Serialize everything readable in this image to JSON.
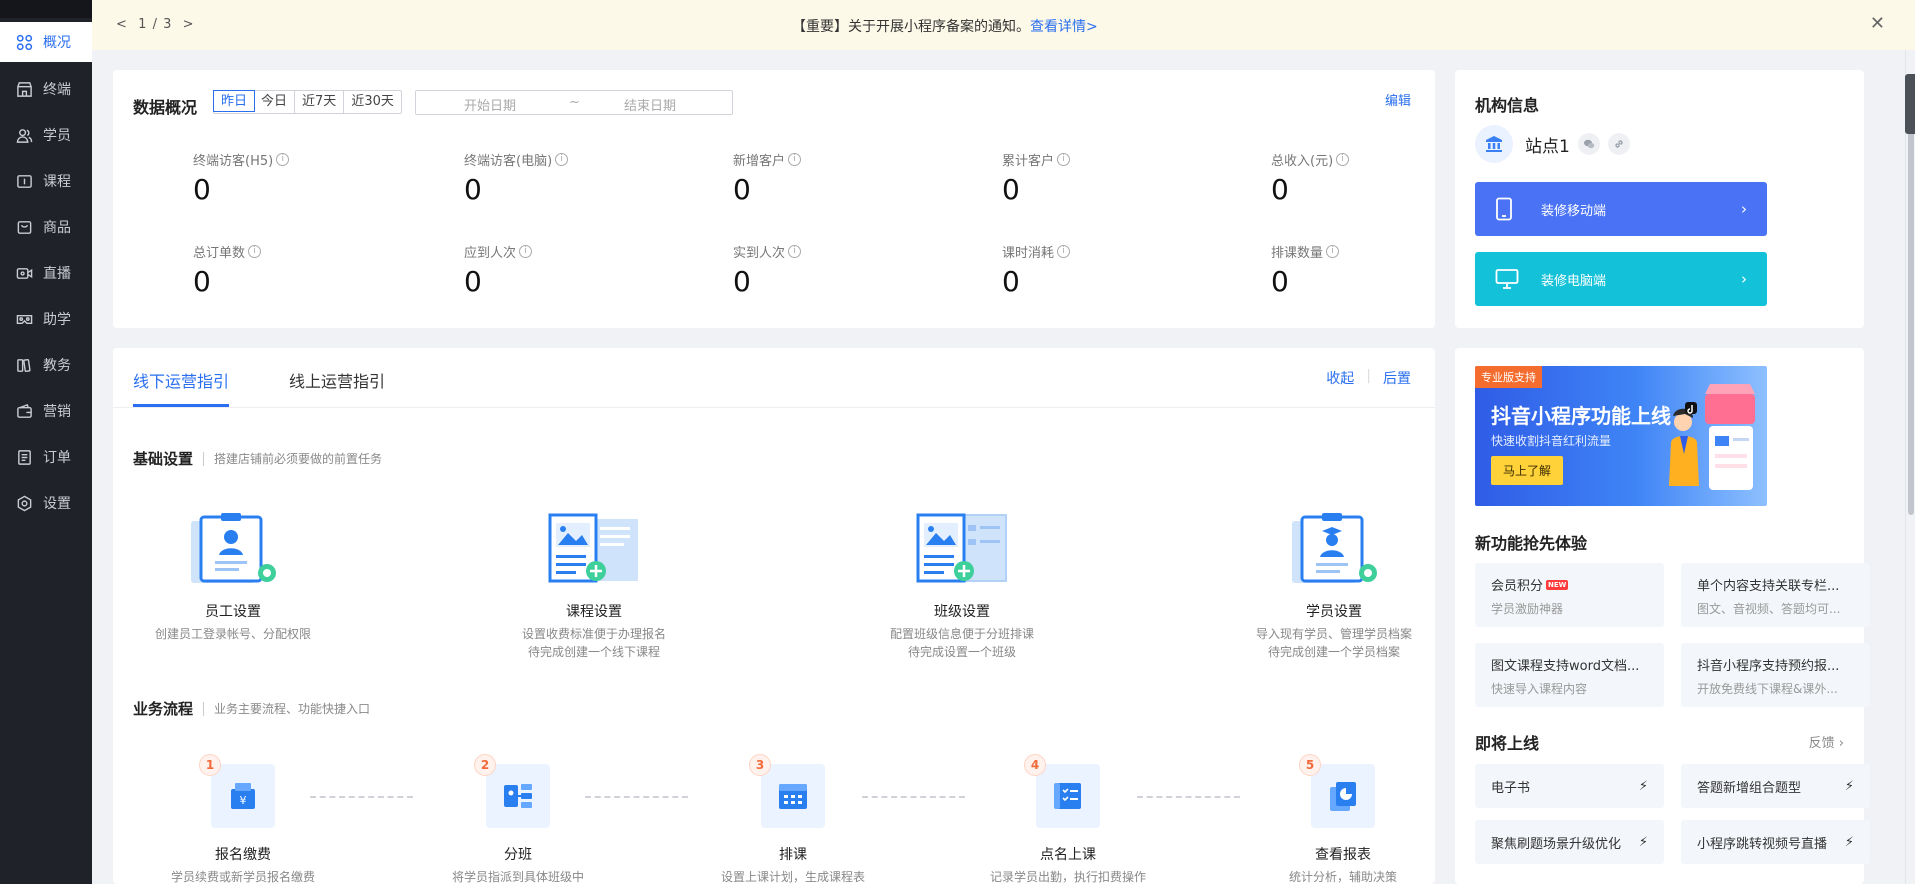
{
  "sidebar": {
    "items": [
      {
        "label": "概况",
        "icon": "grid-icon"
      },
      {
        "label": "终端",
        "icon": "store-icon"
      },
      {
        "label": "学员",
        "icon": "users-icon"
      },
      {
        "label": "课程",
        "icon": "course-icon"
      },
      {
        "label": "商品",
        "icon": "bag-icon"
      },
      {
        "label": "直播",
        "icon": "live-icon"
      },
      {
        "label": "助学",
        "icon": "vr-icon"
      },
      {
        "label": "教务",
        "icon": "book-icon"
      },
      {
        "label": "营销",
        "icon": "wallet-icon"
      },
      {
        "label": "订单",
        "icon": "order-icon"
      },
      {
        "label": "设置",
        "icon": "gear-icon"
      }
    ]
  },
  "notice": {
    "pager_prev": "<",
    "pager_text": "1 / 3",
    "pager_next": ">",
    "text": "【重要】关于开展小程序备案的通知。",
    "link": "查看详情>",
    "close": "✕"
  },
  "overview": {
    "title": "数据概况",
    "ranges": [
      "昨日",
      "今日",
      "近7天",
      "近30天"
    ],
    "active_range": "昨日",
    "start_placeholder": "开始日期",
    "sep": "~",
    "end_placeholder": "结束日期",
    "edit": "编辑",
    "stats": [
      {
        "label": "终端访客(H5)",
        "value": "0"
      },
      {
        "label": "终端访客(电脑)",
        "value": "0"
      },
      {
        "label": "新增客户",
        "value": "0"
      },
      {
        "label": "累计客户",
        "value": "0"
      },
      {
        "label": "总收入(元)",
        "value": "0"
      },
      {
        "label": "总订单数",
        "value": "0"
      },
      {
        "label": "应到人次",
        "value": "0"
      },
      {
        "label": "实到人次",
        "value": "0"
      },
      {
        "label": "课时消耗",
        "value": "0"
      },
      {
        "label": "排课数量",
        "value": "0"
      }
    ]
  },
  "guide": {
    "tabs": [
      "线下运营指引",
      "线上运营指引"
    ],
    "collapse": "收起",
    "pin_bottom": "后置",
    "basic": {
      "title": "基础设置",
      "desc": "搭建店铺前必须要做的前置任务",
      "items": [
        {
          "title": "员工设置",
          "desc1": "创建员工登录帐号、分配权限",
          "desc2": ""
        },
        {
          "title": "课程设置",
          "desc1": "设置收费标准便于办理报名",
          "desc2": "待完成创建一个线下课程"
        },
        {
          "title": "班级设置",
          "desc1": "配置班级信息便于分班排课",
          "desc2": "待完成设置一个班级"
        },
        {
          "title": "学员设置",
          "desc1": "导入现有学员、管理学员档案",
          "desc2": "待完成创建一个学员档案"
        }
      ]
    },
    "flow": {
      "title": "业务流程",
      "desc": "业务主要流程、功能快捷入口",
      "items": [
        {
          "num": "1",
          "title": "报名缴费",
          "desc": "学员续费或新学员报名缴费"
        },
        {
          "num": "2",
          "title": "分班",
          "desc": "将学员指派到具体班级中"
        },
        {
          "num": "3",
          "title": "排课",
          "desc": "设置上课计划，生成课程表"
        },
        {
          "num": "4",
          "title": "点名上课",
          "desc": "记录学员出勤，执行扣费操作"
        },
        {
          "num": "5",
          "title": "查看报表",
          "desc": "统计分析，辅助决策"
        }
      ]
    }
  },
  "org": {
    "title": "机构信息",
    "site_name": "站点1",
    "mobile_button": "装修移动端",
    "pc_button": "装修电脑端",
    "colors": {
      "mobile": "#4a72f5",
      "pc": "#13c2d8"
    }
  },
  "banner": {
    "tag": "专业版支持",
    "title": "抖音小程序功能上线",
    "subtitle": "快速收割抖音红利流量",
    "button": "马上了解"
  },
  "new_features": {
    "title": "新功能抢先体验",
    "badge": "NEW",
    "items": [
      {
        "title": "会员积分",
        "sub": "学员激励神器",
        "is_new": true
      },
      {
        "title": "单个内容支持关联专栏...",
        "sub": "图文、音视频、答题均可..."
      },
      {
        "title": "图文课程支持word文档...",
        "sub": "快速导入课程内容"
      },
      {
        "title": "抖音小程序支持预约报...",
        "sub": "开放免费线下课程&课外..."
      }
    ]
  },
  "coming_soon": {
    "title": "即将上线",
    "feedback": "反馈 ›",
    "items": [
      "电子书",
      "答题新增组合题型",
      "聚焦刷题场景升级优化",
      "小程序跳转视频号直播"
    ]
  }
}
